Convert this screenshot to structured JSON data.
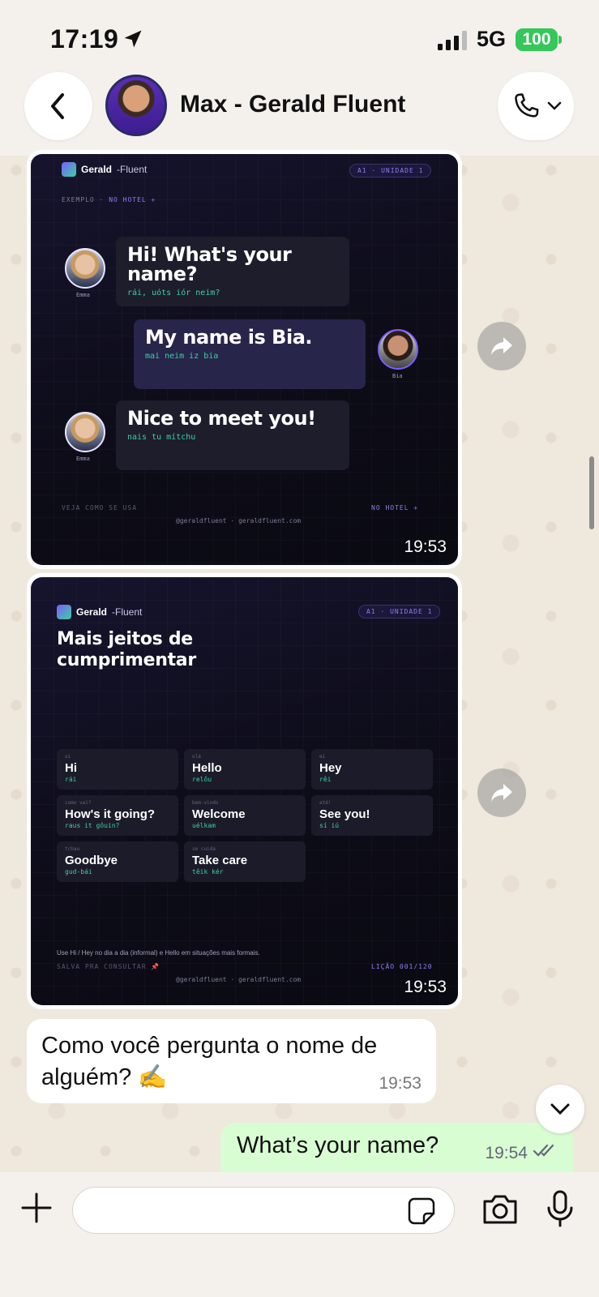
{
  "status_bar": {
    "time": "17:19",
    "network": "5G",
    "battery": "100"
  },
  "header": {
    "contact_name": "Max - Gerald Fluent"
  },
  "card1": {
    "brand_bold": "Gerald",
    "brand_thin": "-Fluent",
    "level": "A1 · UNIDADE 1",
    "context_label": "EXEMPLO ·",
    "context_place": "NO HOTEL ✈",
    "dialogue": [
      {
        "speaker": "Emma",
        "text": "Hi! What's your name?",
        "phonetic": "rái, uóts iór neim?"
      },
      {
        "speaker": "Bia",
        "text": "My name is Bia.",
        "phonetic": "mai neim iz bia"
      },
      {
        "speaker": "Emma",
        "text": "Nice to meet you!",
        "phonetic": "nais tu mítchu"
      }
    ],
    "footer_left": "VEJA COMO SE USA",
    "footer_right": "NO HOTEL ✈",
    "handle": "@geraldfluent · geraldfluent.com",
    "time": "19:53"
  },
  "card2": {
    "brand_bold": "Gerald",
    "brand_thin": "-Fluent",
    "level": "A1 · UNIDADE 1",
    "title_line1": "Mais jeitos de",
    "title_line2": "cumprimentar",
    "tiles": [
      {
        "label": "oi",
        "word": "Hi",
        "phonetic": "rái"
      },
      {
        "label": "olá",
        "word": "Hello",
        "phonetic": "relôu"
      },
      {
        "label": "ei",
        "word": "Hey",
        "phonetic": "rêi"
      },
      {
        "label": "como vai?",
        "word": "How's it going?",
        "phonetic": "raus it gôuin?"
      },
      {
        "label": "bem-vindo",
        "word": "Welcome",
        "phonetic": "uélkam"
      },
      {
        "label": "até!",
        "word": "See you!",
        "phonetic": "sí iú"
      },
      {
        "label": "tchau",
        "word": "Goodbye",
        "phonetic": "gud-bái"
      },
      {
        "label": "se cuida",
        "word": "Take care",
        "phonetic": "têik kér"
      }
    ],
    "note": "Use Hi / Hey no dia a dia (informal) e Hello em situações mais formais.",
    "footer_left": "SALVA PRA CONSULTAR 📌",
    "footer_right": "LIÇÃO 001/120",
    "handle": "@geraldfluent · geraldfluent.com",
    "time": "19:53"
  },
  "incoming_message": {
    "text": "Como você pergunta o nome de alguém? ✍️",
    "time": "19:53"
  },
  "outgoing_message": {
    "text": "What’s your name?",
    "time": "19:54"
  },
  "composer": {
    "placeholder": ""
  }
}
